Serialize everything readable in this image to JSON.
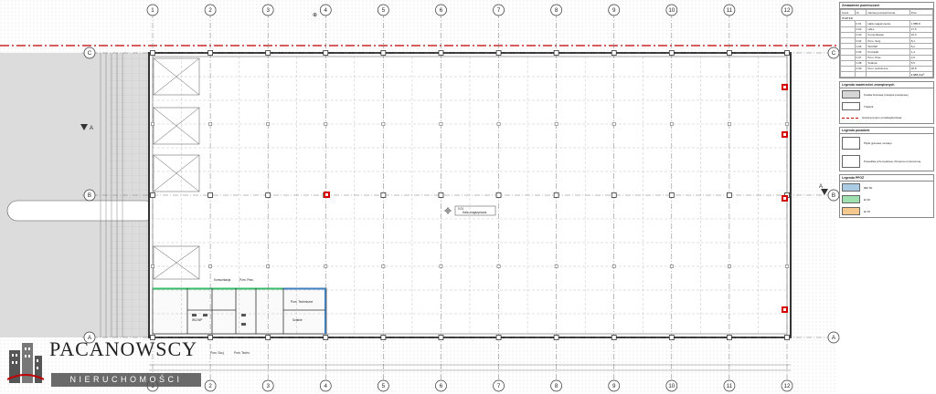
{
  "grid": {
    "columns": [
      "1",
      "2",
      "3",
      "4",
      "5",
      "6",
      "7",
      "8",
      "9",
      "10",
      "11",
      "12"
    ],
    "rows": [
      "C",
      "B",
      "A"
    ]
  },
  "section_markers": [
    "A",
    "A"
  ],
  "room_labels": {
    "main_hall_code": "0.01",
    "main_hall_name": "Hala magazynowa",
    "office_a": "Komunikacja",
    "office_b": "Pom. Prac.",
    "office_c": "Pom. Socj.",
    "office_d": "Pom. Techn.",
    "office_e": "WC/WP",
    "office_f": "Pom. Techniczne",
    "office_g": "Szatnie"
  },
  "room_table": {
    "title": "Zestawienie pomieszczeń",
    "headers": [
      "Kond.",
      "Nr",
      "Nazwa pomieszczenia",
      "Pow."
    ],
    "floor": "PARTER",
    "rows": [
      [
        "",
        "0.01",
        "Hala magazynowa",
        "1 885,8"
      ],
      [
        "",
        "0.02",
        "HALL",
        "17,5"
      ],
      [
        "",
        "0.03",
        "Komunikacja",
        "10,3"
      ],
      [
        "",
        "0.04",
        "Pom. Socj.",
        "8,1"
      ],
      [
        "",
        "0.05",
        "WC/WP",
        "5,2"
      ],
      [
        "",
        "0.06",
        "Porządki",
        "1,4"
      ],
      [
        "",
        "0.07",
        "Pom. Prac.",
        "2,6"
      ],
      [
        "",
        "0.08",
        "Szatnia",
        "5,5"
      ],
      [
        "",
        "0.09",
        "Pom. techniczne",
        "20,8"
      ]
    ],
    "total": "1 957,4 m²"
  },
  "legend_surfaces": {
    "title": "Legenda nawierzchni zewnętrznych",
    "items": [
      {
        "label": "Kostka brukowa (miejsca postojowe)",
        "color": "#d6d6d6"
      },
      {
        "label": "Trawnik",
        "color": "#ffffff"
      },
      {
        "label": "Granica terenu przedsiębiorstwa",
        "color": "#c00000",
        "dashed": true
      }
    ]
  },
  "legend_floors": {
    "title": "Legenda posadzek",
    "items": [
      {
        "label": "Płytki gresowe na kleju",
        "color": "#ffffff"
      },
      {
        "label": "Posadzka przemysłowa, zbrojona rozproszona",
        "color": "#ffffff"
      }
    ]
  },
  "legend_fire": {
    "title": "Legenda PPOŻ",
    "items": [
      {
        "label": "REI 60",
        "color": "#a9cbe3"
      },
      {
        "label": "EI 30",
        "color": "#9fe0b0"
      },
      {
        "label": "EI 15",
        "color": "#f3c98f"
      }
    ]
  },
  "logo": {
    "name": "PACANOWSCY",
    "subtitle": "NIERUCHOMOŚCI"
  },
  "colors": {
    "line": "#333333",
    "grid_dash": "#777777",
    "paving": "#dcdcdc",
    "hydrant": "#d40000",
    "boundary": "#c00000"
  }
}
